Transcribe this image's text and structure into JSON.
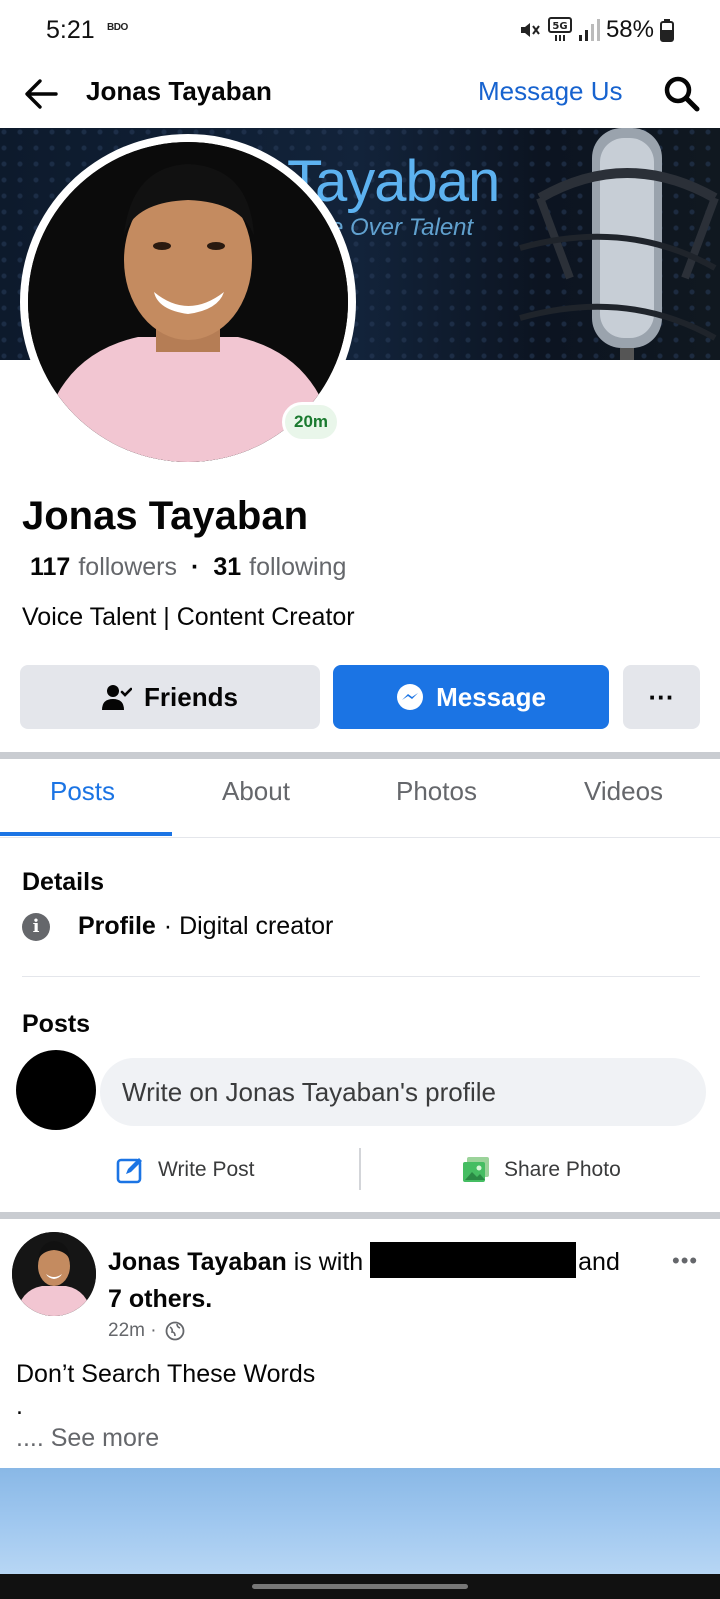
{
  "status_bar": {
    "time": "5:21",
    "carrier_badge": "BDO",
    "network": "5G",
    "battery": "58%",
    "icons": [
      "mute-icon",
      "network-5g-icon",
      "signal-icon",
      "battery-icon"
    ]
  },
  "top_nav": {
    "title": "Jonas Tayaban",
    "message_us": "Message Us",
    "icons": [
      "back-arrow-icon",
      "search-icon"
    ]
  },
  "cover": {
    "title_text": "Tayaban",
    "subtitle_text": "e Over Talent"
  },
  "profile": {
    "active_badge": "20m",
    "name": "Jonas Tayaban",
    "followers_count": "117",
    "followers_label": "followers",
    "separator": "·",
    "following_count": "31",
    "following_label": "following",
    "bio": "Voice Talent | Content Creator"
  },
  "actions": {
    "friends_label": "Friends",
    "message_label": "Message",
    "more_label": "···"
  },
  "tabs": [
    {
      "label": "Posts",
      "active": true
    },
    {
      "label": "About",
      "active": false
    },
    {
      "label": "Photos",
      "active": false
    },
    {
      "label": "Videos",
      "active": false
    }
  ],
  "details": {
    "heading": "Details",
    "info_icon_glyph": "i",
    "label": "Profile",
    "value": "· Digital creator"
  },
  "posts_section": {
    "heading": "Posts",
    "composer_placeholder": "Write on Jonas Tayaban's profile",
    "write_post_label": "Write Post",
    "share_photo_label": "Share Photo"
  },
  "post": {
    "author": "Jonas Tayaban",
    "is_with": "is with",
    "and": "and",
    "others": "7 others.",
    "time": "22m ·",
    "text": "Don’t Search These Words",
    "text_line2": ".",
    "see_more": ".... See more",
    "more_glyph": "•••"
  },
  "colors": {
    "accent": "#1b74e4",
    "link": "#1763cf",
    "secondary_text": "#65676b",
    "button_grey": "#e4e6eb",
    "active_green": "#1a7a2f"
  }
}
